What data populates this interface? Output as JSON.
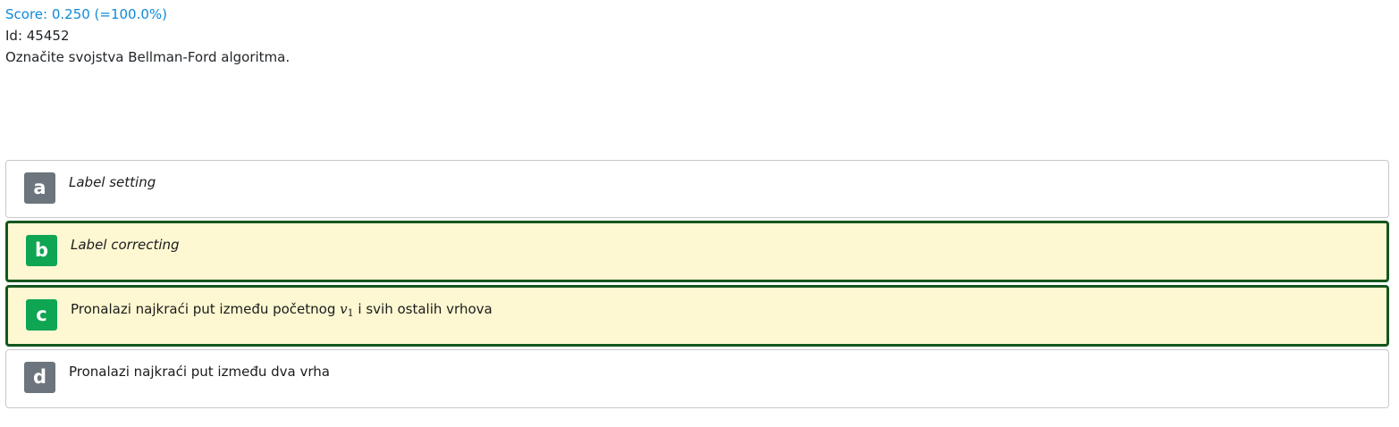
{
  "header": {
    "score": "Score: 0.250 (=100.0%)",
    "id": "Id: 45452",
    "question": "Označite svojstva Bellman-Ford algoritma."
  },
  "answers": [
    {
      "letter": "a",
      "text": "Label setting",
      "selected": false
    },
    {
      "letter": "b",
      "text": "Label correcting",
      "selected": true
    },
    {
      "letter": "c",
      "text_before": "Pronalazi najkraći put između početnog",
      "math_var": "v",
      "math_sub": "1",
      "text_after": "i svih ostalih vrhova",
      "selected": true
    },
    {
      "letter": "d",
      "text": "Pronalazi najkraći put između dva vrha",
      "selected": false
    }
  ],
  "colors": {
    "score": "#0d8ad8",
    "selected_border": "#14571f",
    "selected_background": "#fdf8d2",
    "letter_gray": "#6c757d",
    "letter_green": "#0ea553"
  }
}
